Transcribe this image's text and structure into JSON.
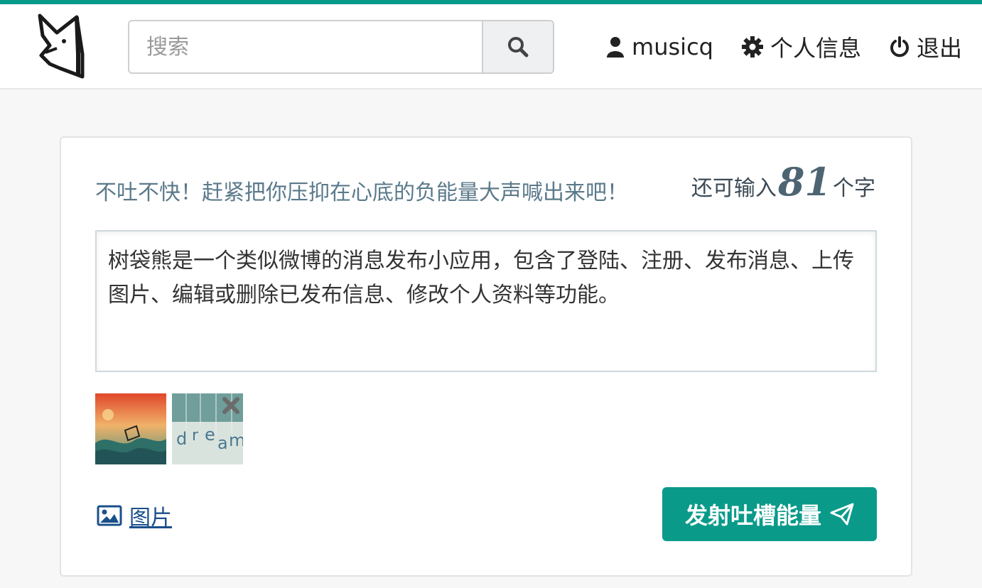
{
  "header": {
    "logo_name": "fox-logo",
    "search": {
      "placeholder": "搜索",
      "value": ""
    },
    "nav": [
      {
        "label": "musicq",
        "icon": "user-icon"
      },
      {
        "label": "个人信息",
        "icon": "gear-icon"
      },
      {
        "label": "退出",
        "icon": "power-icon"
      }
    ]
  },
  "composer": {
    "prompt": "不吐不快！赶紧把你压抑在心底的负能量大声喊出来吧！",
    "counter": {
      "prefix": "还可输入",
      "remaining": "81",
      "suffix": "个字"
    },
    "text": "树袋熊是一个类似微博的消息发布小应用，包含了登陆、注册、发布消息、上传图片、编辑或删除已发布信息、修改个人资料等功能。",
    "thumbnails": [
      {
        "name": "thumbnail-sea-painting"
      },
      {
        "name": "thumbnail-dream"
      }
    ],
    "image_link_label": "图片",
    "submit_label": "发射吐槽能量"
  },
  "colors": {
    "accent": "#0a9a8a",
    "prompt_text": "#5b7a8b",
    "link": "#1a4f8b"
  }
}
